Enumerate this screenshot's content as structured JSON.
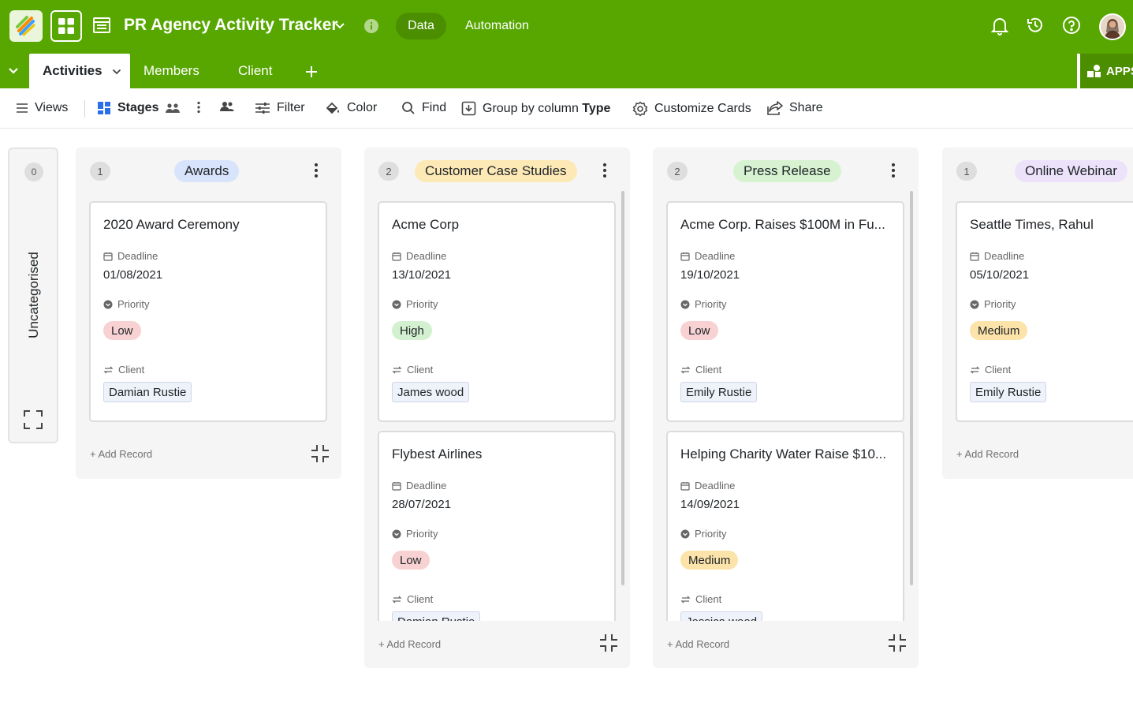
{
  "app": {
    "base_title": "PR Agency Activity Tracker",
    "top_tabs": {
      "data": "Data",
      "automation": "Automation"
    }
  },
  "tabs": {
    "active": "Activities",
    "items": [
      "Members",
      "Client"
    ],
    "apps_label": "APPS"
  },
  "toolbar": {
    "views": "Views",
    "stages": "Stages",
    "filter": "Filter",
    "color": "Color",
    "find": "Find",
    "group_by_prefix": "Group by column",
    "group_by_value": "Type",
    "customize": "Customize Cards",
    "share": "Share"
  },
  "board": {
    "uncategorised": {
      "count": "0",
      "title": "Uncategorised"
    },
    "field_labels": {
      "deadline": "Deadline",
      "priority": "Priority",
      "client": "Client"
    },
    "add_record": "+ Add Record",
    "columns": [
      {
        "count": "1",
        "stage": "Awards",
        "stage_color": "#d8e4fb",
        "cards": [
          {
            "title": "2020 Award Ceremony",
            "deadline": "01/08/2021",
            "priority": "Low",
            "client": "Damian Rustie"
          }
        ]
      },
      {
        "count": "2",
        "stage": "Customer Case Studies",
        "stage_color": "#fde9b6",
        "cards": [
          {
            "title": "Acme Corp",
            "deadline": "13/10/2021",
            "priority": "High",
            "client": "James wood"
          },
          {
            "title": "Flybest Airlines",
            "deadline": "28/07/2021",
            "priority": "Low",
            "client": "Damian Rustie"
          }
        ]
      },
      {
        "count": "2",
        "stage": "Press Release",
        "stage_color": "#d6f2d1",
        "cards": [
          {
            "title": "Acme Corp. Raises $100M in Fu...",
            "deadline": "19/10/2021",
            "priority": "Low",
            "client": "Emily Rustie"
          },
          {
            "title": "Helping Charity Water Raise $10...",
            "deadline": "14/09/2021",
            "priority": "Medium",
            "client": "Jessica wood"
          }
        ]
      },
      {
        "count": "1",
        "stage": "Online Webinar",
        "stage_color": "#ece3fb",
        "cards": [
          {
            "title": "Seattle Times, Rahul",
            "deadline": "05/10/2021",
            "priority": "Medium",
            "client": "Emily Rustie"
          }
        ]
      }
    ]
  },
  "colors": {
    "topbar": "#57a700",
    "priority_low": "#f8d2d2",
    "priority_high": "#d3f1d0",
    "priority_medium": "#fbe3a9"
  },
  "icons": {
    "app_logo": "layers-logo-icon",
    "app_switcher": "grid-icon",
    "table": "table-icon",
    "notifications": "bell-icon",
    "history": "history-icon",
    "help": "question-icon"
  }
}
